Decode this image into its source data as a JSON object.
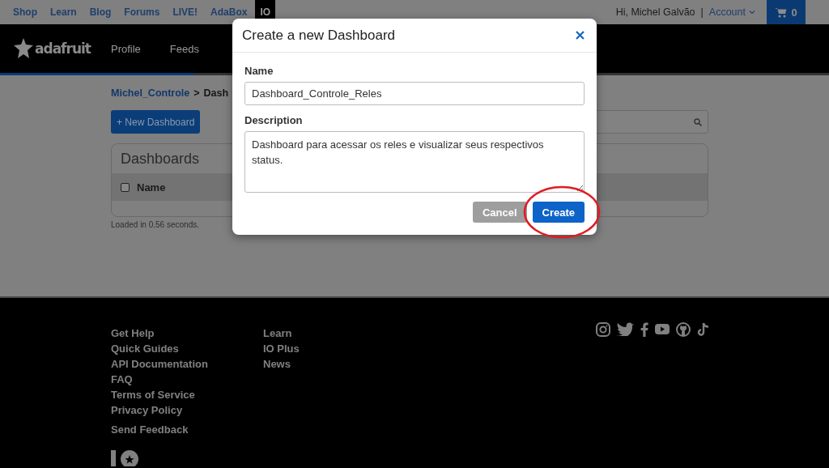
{
  "top_bar": {
    "links": [
      {
        "label": "Shop",
        "selected": false
      },
      {
        "label": "Learn",
        "selected": false
      },
      {
        "label": "Blog",
        "selected": false
      },
      {
        "label": "Forums",
        "selected": false
      },
      {
        "label": "LIVE!",
        "selected": false
      },
      {
        "label": "AdaBox",
        "selected": false
      },
      {
        "label": "IO",
        "selected": true
      }
    ],
    "greeting": "Hi, Michel Galvão",
    "separator": "|",
    "account": "Account",
    "cart_count": "0"
  },
  "header": {
    "logo": "adafruit",
    "nav": [
      "Profile",
      "Feeds"
    ]
  },
  "breadcrumb": {
    "items": [
      "Michel_Controle",
      "Dash"
    ],
    "separator": ">"
  },
  "new_button": "+ New Dashboard",
  "card": {
    "title": "Dashboards",
    "select_all_checked": false,
    "columns": [
      "Name"
    ]
  },
  "load_time": "Loaded in 0.56 seconds.",
  "footer": {
    "columns": [
      [
        "Get Help",
        "Quick Guides",
        "API Documentation",
        "FAQ",
        "Terms of Service",
        "Privacy Policy"
      ],
      [
        "Learn",
        "IO Plus",
        "News"
      ]
    ],
    "send_feedback": "Send Feedback"
  },
  "modal": {
    "title": "Create a new Dashboard",
    "fields": [
      {
        "kind": "input",
        "label": "Name",
        "value": "Dashboard_Controle_Reles"
      },
      {
        "kind": "textarea",
        "label": "Description",
        "value": "Dashboard para acessar os reles e visualizar seus respectivos status."
      }
    ],
    "buttons": [
      {
        "kind": "secondary",
        "label": "Cancel",
        "highlighted": false
      },
      {
        "kind": "primary",
        "label": "Create",
        "highlighted": true
      }
    ]
  }
}
